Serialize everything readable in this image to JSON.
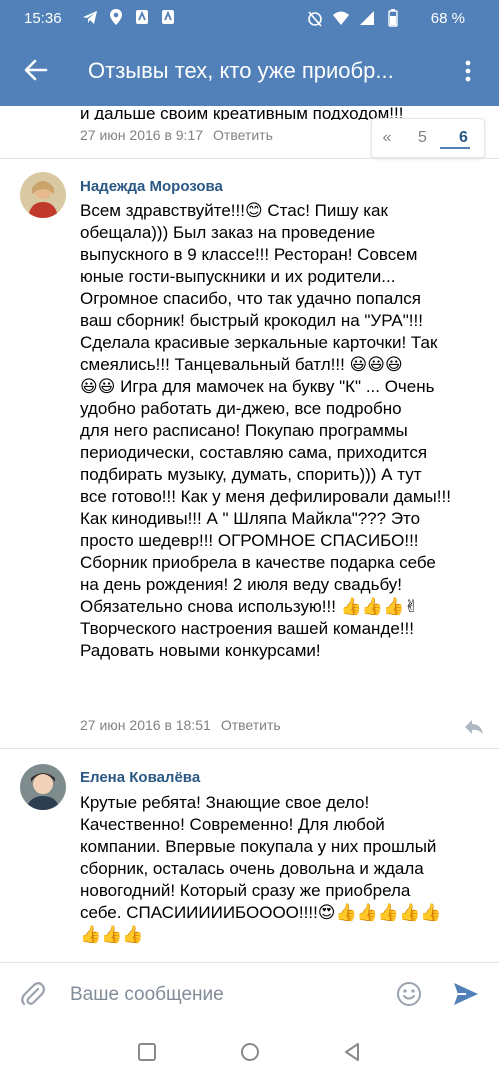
{
  "status": {
    "time": "15:36",
    "battery": "68 %"
  },
  "header": {
    "title": "Отзывы тех, кто уже приобр..."
  },
  "previous_comment": {
    "text_tail": "и дальше своим креативным подходом!!!",
    "date": "27 июн 2016 в 9:17",
    "reply": "Ответить"
  },
  "pager": {
    "prev": "«",
    "pages": [
      "5",
      "6"
    ],
    "active": "6"
  },
  "comments": [
    {
      "author": "Надежда Морозова",
      "text": "Всем здравствуйте!!!😊 Стас! Пишу как\nобещала))) Был заказ на проведение\nвыпускного в 9 классе!!! Ресторан! Совсем\nюные гости-выпускники и их родители...\nОгромное спасибо, что так удачно попался\nваш сборник! быстрый крокодил на \"УРА\"!!!\nСделала красивые зеркальные карточки! Так\nсмеялись!!! Танцевальный батл!!! 😃😃😃\n😃😃 Игра для мамочек на букву \"К\" ... Очень\nудобно работать ди-джею, все подробно\nдля него расписано! Покупаю программы\nпериодически, составляю сама, приходится\nподбирать музыку, думать, спорить))) А тут\nвсе готово!!! Как у меня дефилировали дамы!!!\nКак кинодивы!!! А \" Шляпа Майкла\"??? Это\nпросто шедевр!!! ОГРОМНОЕ СПАСИБО!!!\nСборник приобрела в качестве подарка себе\nна день рождения! 2 июля веду свадьбу!\nОбязательно снова использую!!! 👍👍👍✌\nТворческого настроения вашей команде!!!\nРадовать новыми конкурсами!",
      "date": "27 июн 2016 в 18:51",
      "reply": "Ответить"
    },
    {
      "author": "Елена Ковалёва",
      "text": "Крутые ребята! Знающие свое дело!\nКачественно! Современно! Для любой\nкомпании. Впервые покупала у них прошлый\nсборник, осталась очень довольна и ждала\nновогодний! Который сразу же приобрела\nсебе. СПАСИИИИИБОООО!!!!😍👍👍👍👍👍\n👍👍👍"
    }
  ],
  "composer": {
    "placeholder": "Ваше сообщение"
  },
  "colors": {
    "header_bg": "#5181b8",
    "link": "#2a5885",
    "meta": "#828282"
  },
  "icons": [
    "back-arrow-icon",
    "more-vertical-icon",
    "reply-arrow-icon",
    "attach-icon",
    "emoji-icon",
    "send-icon",
    "nav-square-icon",
    "nav-circle-icon",
    "nav-back-triangle-icon"
  ]
}
